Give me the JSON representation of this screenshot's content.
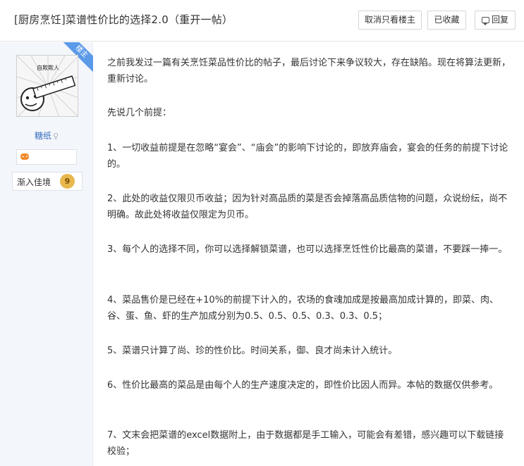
{
  "header": {
    "title": "[厨房烹饪]菜谱性价比的选择2.0（重开一帖）",
    "buttons": {
      "unfollow": "取消只看楼主",
      "favorited": "已收藏",
      "reply": "回复"
    }
  },
  "author": {
    "badge": "楼主",
    "username": "糖纸",
    "avatar_text": "自欺欺人",
    "rank_label": "渐入佳境",
    "rank_level": "9"
  },
  "post": {
    "paragraphs": [
      "之前我发过一篇有关烹饪菜品性价比的帖子，最后讨论下来争议较大，存在缺陷。现在将算法更新，重新讨论。",
      "先说几个前提：",
      "1、一切收益前提是在忽略“宴会”、“庙会”的影响下讨论的，即放弃庙会，宴会的任务的前提下讨论的。",
      "2、此处的收益仅限贝币收益；因为针对高品质的菜是否会掉落高品质信物的问题，众说纷纭，尚不明确。故此处将收益仅限定为贝币。",
      "3、每个人的选择不同，你可以选择解锁菜谱，也可以选择烹饪性价比最高的菜谱，不要踩一捧一。",
      "4、菜品售价是已经在+10%的前提下计入的，农场的食魂加成是按最高加成计算的，即菜、肉、谷、蛋、鱼、虾的生产加成分别为0.5、0.5、0.5、0.3、0.3、0.5；",
      "5、菜谱只计算了尚、珍的性价比。时间关系，御、良才尚未计入统计。",
      "6、性价比最高的菜品是由每个人的生产速度决定的，即性价比因人而异。本帖的数据仅供参考。",
      "7、文末会把菜谱的excel数据附上，由于数据都是手工输入，可能会有差错，感兴趣可以下载链接校验；"
    ]
  },
  "colors": {
    "sidebar_bg": "#f3f6fb",
    "username": "#3a6fbf",
    "badge": "#5b9ae8",
    "rank_coin": "#e8b84d"
  }
}
